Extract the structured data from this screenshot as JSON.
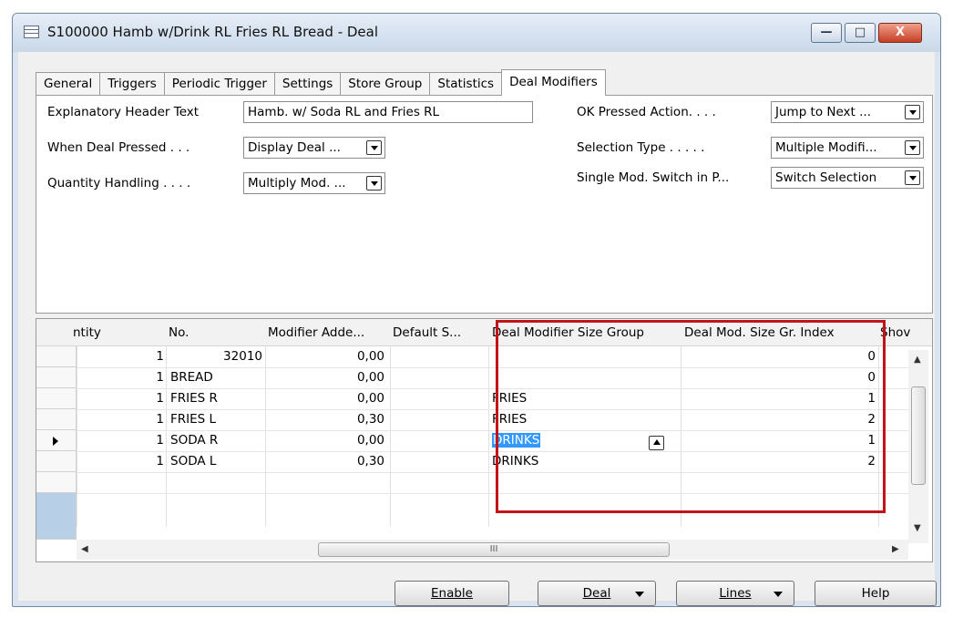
{
  "window": {
    "title": "S100000 Hamb w/Drink RL Fries RL Bread - Deal",
    "controls": {
      "minimize": "—",
      "maximize": "□",
      "close": "X"
    }
  },
  "tabs": [
    "General",
    "Triggers",
    "Periodic Trigger",
    "Settings",
    "Store Group",
    "Statistics",
    "Deal Modifiers"
  ],
  "active_tab": "Deal Modifiers",
  "form": {
    "explanatory_header_label": "Explanatory Header Text",
    "explanatory_header_value": "Hamb. w/ Soda RL and Fries RL",
    "when_pressed_label": "When Deal Pressed . . .",
    "when_pressed_value": "Display Deal ...",
    "quantity_label": "Quantity Handling . . . .",
    "quantity_value": "Multiply Mod. ...",
    "ok_pressed_label": "OK Pressed Action. . . .",
    "ok_pressed_value": "Jump to Next ...",
    "selection_type_label": "Selection Type . . . . .",
    "selection_type_value": "Multiple Modifi...",
    "single_switch_label": "Single Mod. Switch in P...",
    "single_switch_value": "Switch Selection"
  },
  "grid": {
    "headers": [
      "ntity",
      "No.",
      "Modifier Adde...",
      "Default S...",
      "Deal Modifier Size Group",
      "Deal Mod. Size Gr. Index",
      "Shov"
    ],
    "rows": [
      {
        "qty": "1",
        "no": "32010",
        "modifier": "0,00",
        "default": "",
        "group": "",
        "index": "0"
      },
      {
        "qty": "1",
        "no": "BREAD",
        "modifier": "0,00",
        "default": "",
        "group": "",
        "index": "0"
      },
      {
        "qty": "1",
        "no": "FRIES R",
        "modifier": "0,00",
        "default": "",
        "group": "FRIES",
        "index": "1"
      },
      {
        "qty": "1",
        "no": "FRIES L",
        "modifier": "0,30",
        "default": "",
        "group": "FRIES",
        "index": "2"
      },
      {
        "qty": "1",
        "no": "SODA R",
        "modifier": "0,00",
        "default": "",
        "group": "DRINKS",
        "index": "1"
      },
      {
        "qty": "1",
        "no": "SODA L",
        "modifier": "0,30",
        "default": "",
        "group": "DRINKS",
        "index": "2"
      }
    ]
  },
  "buttons": {
    "enable": "Enable",
    "deal": "Deal",
    "lines": "Lines",
    "help": "Help"
  },
  "scroll": {
    "h_middle_glyph": "III"
  }
}
